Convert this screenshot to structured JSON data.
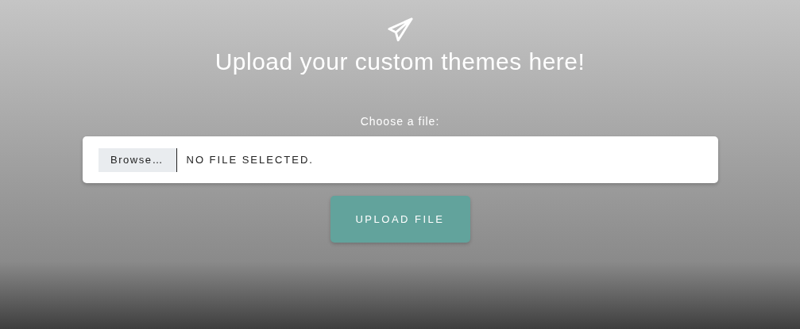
{
  "heading": "Upload your custom themes here!",
  "file_field": {
    "label": "Choose a file:",
    "browse_button": "Browse…",
    "status": "NO FILE SELECTED."
  },
  "upload_button": "UPLOAD FILE"
}
